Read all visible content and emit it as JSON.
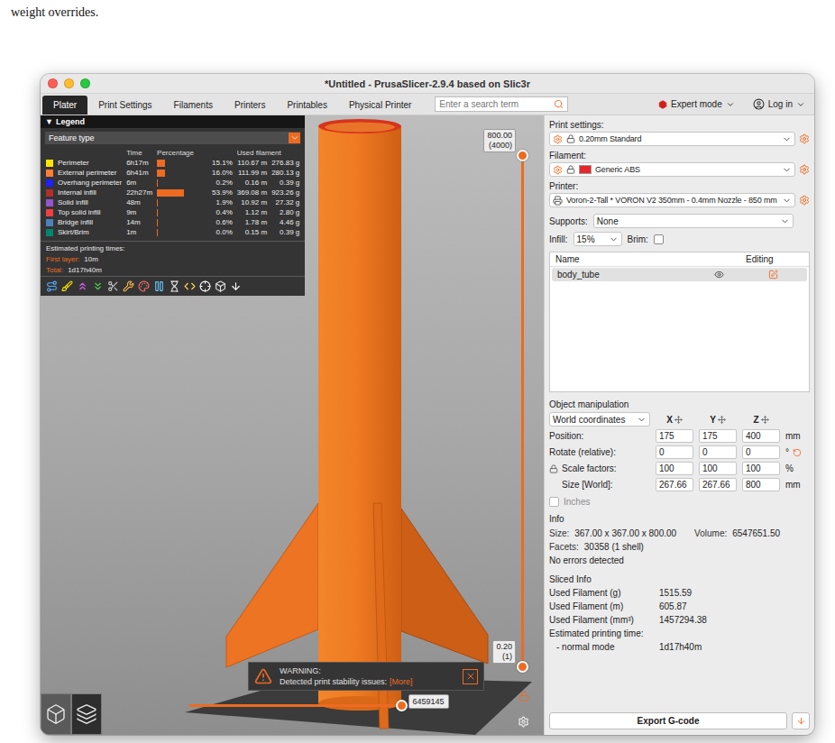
{
  "document_fragment": "weight overrides.",
  "window": {
    "title": "*Untitled - PrusaSlicer-2.9.4 based on Slic3r"
  },
  "tabs": [
    {
      "label": "Plater",
      "selected": true
    },
    {
      "label": "Print Settings",
      "selected": false
    },
    {
      "label": "Filaments",
      "selected": false
    },
    {
      "label": "Printers",
      "selected": false
    },
    {
      "label": "Printables",
      "selected": false
    },
    {
      "label": "Physical Printer",
      "selected": false
    }
  ],
  "search": {
    "placeholder": "Enter a search term"
  },
  "mode": {
    "label": "Expert mode"
  },
  "account": {
    "label": "Log in"
  },
  "legend": {
    "collapse_glyph": "▼",
    "title": "Legend",
    "view_type": "Feature type",
    "columns": [
      "Time",
      "Percentage",
      "Used filament"
    ],
    "rows": [
      {
        "name": "Perimeter",
        "time": "6h17m",
        "percentage": "15.1%",
        "level": 0.151,
        "length": "110.67 m",
        "weight": "276.83 g",
        "color": "#ffe600"
      },
      {
        "name": "External perimeter",
        "time": "6h41m",
        "percentage": "16.0%",
        "level": 0.16,
        "length": "111.99 m",
        "weight": "280.13 g",
        "color": "#ff7d38"
      },
      {
        "name": "Overhang perimeter",
        "time": "6m",
        "percentage": "0.2%",
        "level": 0.002,
        "length": "0.16 m",
        "weight": "0.39 g",
        "color": "#1f1fff"
      },
      {
        "name": "Internal infill",
        "time": "22h27m",
        "percentage": "53.9%",
        "level": 0.539,
        "length": "369.08 m",
        "weight": "923.26 g",
        "color": "#b03029"
      },
      {
        "name": "Solid infill",
        "time": "48m",
        "percentage": "1.9%",
        "level": 0.019,
        "length": "10.92 m",
        "weight": "27.32 g",
        "color": "#9654cc"
      },
      {
        "name": "Top solid infill",
        "time": "9m",
        "percentage": "0.4%",
        "level": 0.004,
        "length": "1.12 m",
        "weight": "2.80 g",
        "color": "#f04040"
      },
      {
        "name": "Bridge infill",
        "time": "14m",
        "percentage": "0.6%",
        "level": 0.006,
        "length": "1.78 m",
        "weight": "4.46 g",
        "color": "#4d80ba"
      },
      {
        "name": "Skirt/Brim",
        "time": "1m",
        "percentage": "0.0%",
        "level": 0.0,
        "length": "0.15 m",
        "weight": "0.39 g",
        "color": "#00876e"
      }
    ],
    "times_title": "Estimated printing times:",
    "times": [
      {
        "label": "First layer:",
        "value": "10m"
      },
      {
        "label": "Total:",
        "value": "1d17h40m"
      }
    ]
  },
  "layer_slider": {
    "top_label": "800.00",
    "top_sub": "(4000)",
    "bottom_label": "0.20",
    "bottom_sub": "(1)",
    "upper_level": 1,
    "lower_level": 0
  },
  "move_slider": {
    "label": "6459145",
    "level": 1
  },
  "notification": {
    "title": "WARNING:",
    "message": "Detected print stability issues:",
    "link": "[More]"
  },
  "view_toolbar": [
    {
      "kind": "3d",
      "selected": false
    },
    {
      "kind": "preview",
      "selected": true
    }
  ],
  "sidebar": {
    "presets": [
      {
        "label": "Print settings:",
        "value": "0.20mm Standard",
        "kind": "print"
      },
      {
        "label": "Filament:",
        "value": "Generic ABS",
        "kind": "filament",
        "color": "#e8262a"
      },
      {
        "label": "Printer:",
        "value": "Voron-2-Tall * VORON V2 350mm - 0.4mm Nozzle - 850 mm",
        "kind": "printer"
      }
    ],
    "supports": {
      "label": "Supports:",
      "value": "None"
    },
    "infill": {
      "label": "Infill:",
      "value": "15%"
    },
    "brim": {
      "label": "Brim:",
      "checked": false
    },
    "object_list": {
      "columns": [
        "Name",
        "Editing"
      ],
      "rows": [
        {
          "name": "body_tube",
          "selected": true,
          "visible": true
        }
      ]
    },
    "object_manipulation": {
      "title": "Object manipulation",
      "coordinates": "World coordinates",
      "axes": [
        "X",
        "Y",
        "Z"
      ],
      "rows": [
        {
          "label": "Position:",
          "values": [
            "175",
            "175",
            "400"
          ],
          "unit": "mm",
          "kind": "position"
        },
        {
          "label": "Rotate (relative):",
          "values": [
            "0",
            "0",
            "0"
          ],
          "unit": "°",
          "kind": "rotation"
        },
        {
          "label": "Scale factors:",
          "values": [
            "100",
            "100",
            "100"
          ],
          "unit": "%",
          "kind": "scale"
        },
        {
          "label": "Size [World]:",
          "values": [
            "267.66",
            "267.66",
            "800"
          ],
          "unit": "mm",
          "kind": "size"
        }
      ],
      "inches": {
        "label": "Inches",
        "checked": false,
        "disabled": true
      }
    },
    "info": {
      "title": "Info",
      "size": {
        "label": "Size:",
        "value": "367.00 x 367.00 x 800.00"
      },
      "volume": {
        "label": "Volume:",
        "value": "6547651.50"
      },
      "facets": {
        "label": "Facets:",
        "value": "30358 (1 shell)"
      },
      "status": "No errors detected"
    },
    "sliced_info": {
      "title": "Sliced Info",
      "rows": [
        {
          "label": "Used Filament (g)",
          "value": "1515.59"
        },
        {
          "label": "Used Filament (m)",
          "value": "605.87"
        },
        {
          "label": "Used Filament (mm³)",
          "value": "1457294.38"
        }
      ],
      "time": {
        "label": "Estimated printing time:",
        "mode": "- normal mode",
        "value": "1d17h40m"
      }
    },
    "export": {
      "label": "Export G-code"
    }
  }
}
